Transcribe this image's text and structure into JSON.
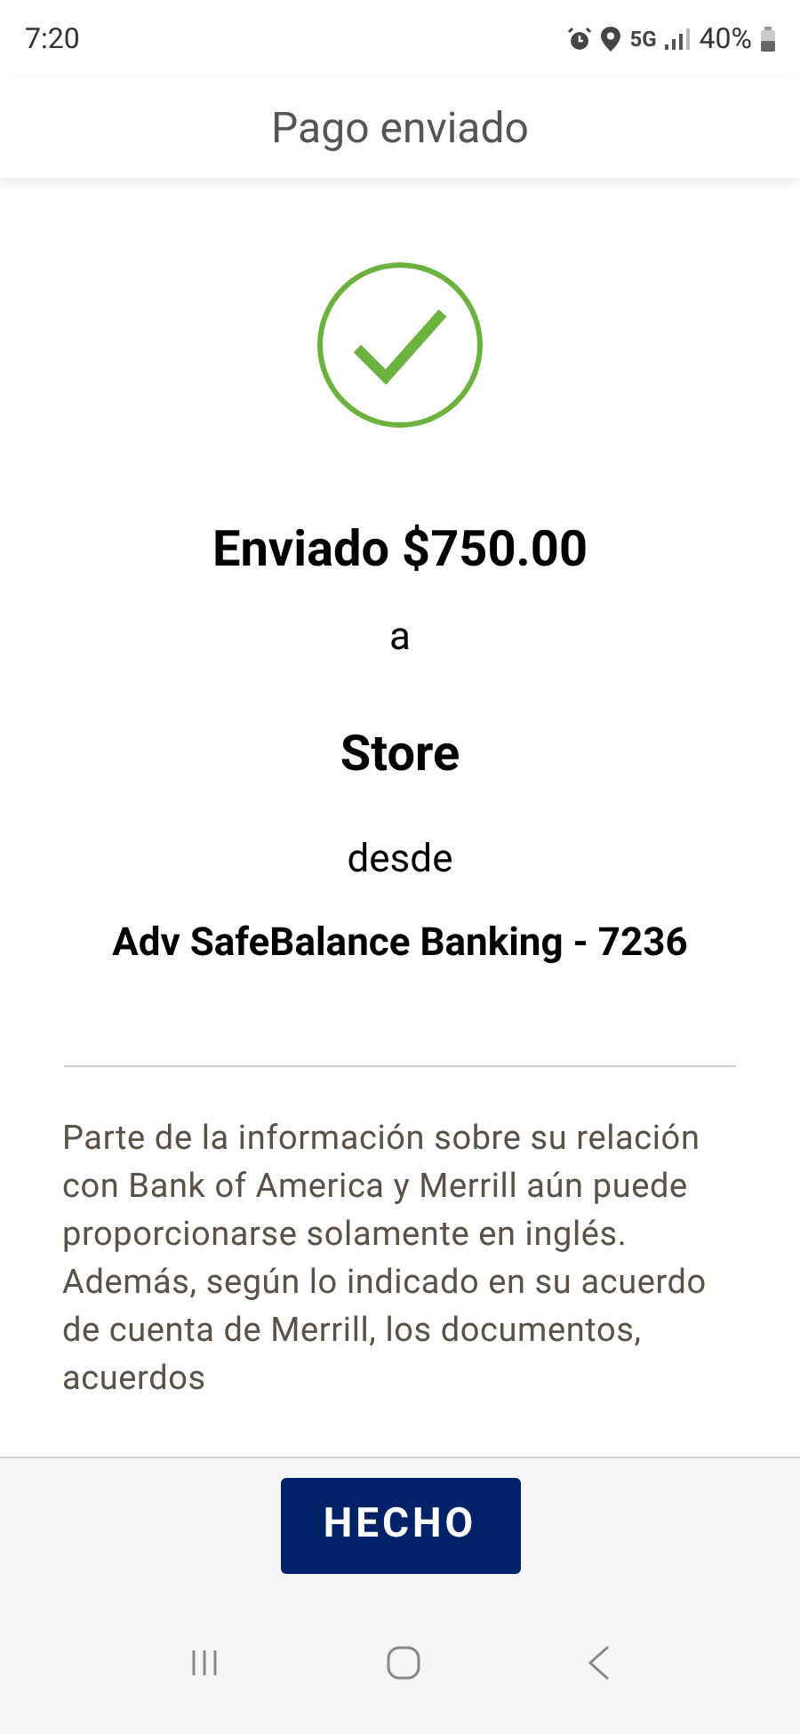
{
  "status_bar": {
    "time": "7:20",
    "network": "5G",
    "battery": "40%"
  },
  "header": {
    "title": "Pago enviado"
  },
  "confirmation": {
    "amount_line": "Enviado $750.00",
    "connector_to": "a",
    "recipient": "Store",
    "connector_from": "desde",
    "account": "Adv SafeBalance Banking - 7236"
  },
  "disclaimer": "Parte de la información sobre su relación con Bank of America y Merrill aún puede proporcionarse solamente en inglés. Además, según lo indicado en su acuerdo de cuenta de Merrill, los documentos, acuerdos",
  "footer": {
    "button": "HECHO"
  }
}
